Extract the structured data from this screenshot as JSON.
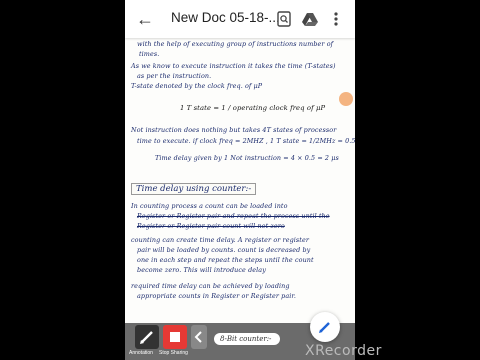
{
  "app": {
    "title": "New Doc 05-18-...",
    "back_icon": "arrow-left-icon",
    "icons": [
      "document-search-icon",
      "drive-icon",
      "more-vert-icon"
    ]
  },
  "page_lines": [
    "with the help of executing group of instructions number of",
    "times.",
    "As we know to execute instruction it takes the time (T-states)",
    "as per the instruction.",
    "T-state denoted by the clock freq. of μP",
    "1 T state = 1 / operating clock freq of μP",
    "Not instruction does nothing but takes 4T states of processor",
    "time to execute. if clock freq = 2MHZ , 1 T state = 1/2MHz = 0.5",
    "Time delay given by 1 Not instruction = 4 × 0.5 = 2 μs"
  ],
  "heading": "Time delay using counter:-",
  "section_lines": [
    "In counting process a count can be loaded into",
    "Register or Register pair and repeat the process until the",
    "Register or Register pair count will not zero",
    "counting can create time delay. A register or register",
    "pair will be loaded by counts. count is decreased by",
    "one in each step and repeat the steps until the count",
    "become zero. This will introduce delay",
    "required time delay can be achieved by loading",
    "appropriate counts in Register or Register pair."
  ],
  "bottom_hint": "8-Bit counter:-",
  "toolbar": {
    "label_left": "Annotation",
    "label_right": "Stop Sharing"
  },
  "watermark": "XRecorder",
  "colors": {
    "ink": "#1a2a6c",
    "toolbar": "#6b6b6b",
    "record_red": "#e53935",
    "annotate_dark": "#333333",
    "fab_blue": "#1e63d6"
  }
}
